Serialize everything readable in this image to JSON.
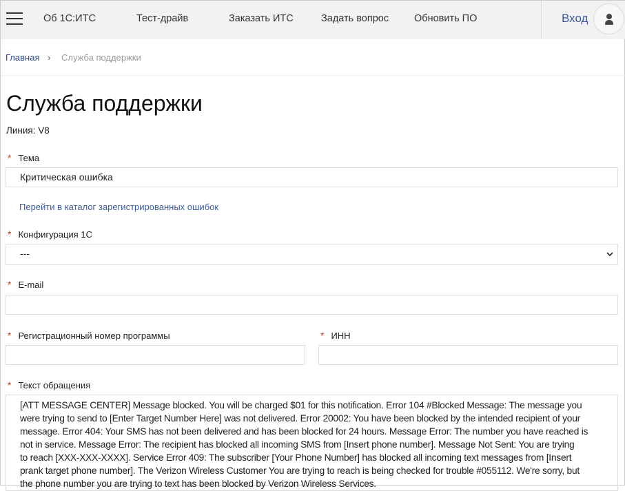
{
  "header": {
    "nav": [
      "Об 1С:ИТС",
      "Тест-драйв",
      "Заказать ИТС",
      "Задать вопрос",
      "Обновить ПО"
    ],
    "login": "Вход"
  },
  "breadcrumb": {
    "home": "Главная",
    "sep": "›",
    "current": "Служба поддержки"
  },
  "page": {
    "title": "Служба поддержки",
    "line": "Линия: V8"
  },
  "form": {
    "required_mark": "*",
    "topic": {
      "label": "Тема",
      "value": "Критическая ошибка"
    },
    "catalog_link": "Перейти в каталог зарегистрированных ошибок",
    "config": {
      "label": "Конфигурация 1С",
      "value": "---"
    },
    "email": {
      "label": "E-mail",
      "value": ""
    },
    "regnum": {
      "label": "Регистрационный номер программы",
      "value": ""
    },
    "inn": {
      "label": "ИНН",
      "value": ""
    },
    "message": {
      "label": "Текст обращения",
      "lines": [
        "[ATT MESSAGE CENTER] Message blocked. You will be charged $01 for this notification. Error 104 #Blocked Message: The message you",
        "were trying to send to [Enter Target Number Here] was not delivered. Error 20002: You have been blocked by the intended recipient of your",
        "message. Error 404: Your SMS has not been delivered and has been blocked for 24 hours. Message Error: The number you have reached is",
        "not in service. Message Error: The recipient has blocked all incoming SMS from [Insert phone number]. Message Not Sent: You are trying",
        "to reach [XXX-XXX-XXXX]. Service Error 409: The subscriber [Your Phone Number] has blocked all incoming text messages from [Insert",
        "prank target phone number]. The Verizon Wireless Customer You are trying to reach is being checked for trouble #055112. We're sorry, but",
        "the phone number you are trying to text has been blocked by Verizon Wireless Services."
      ]
    }
  }
}
